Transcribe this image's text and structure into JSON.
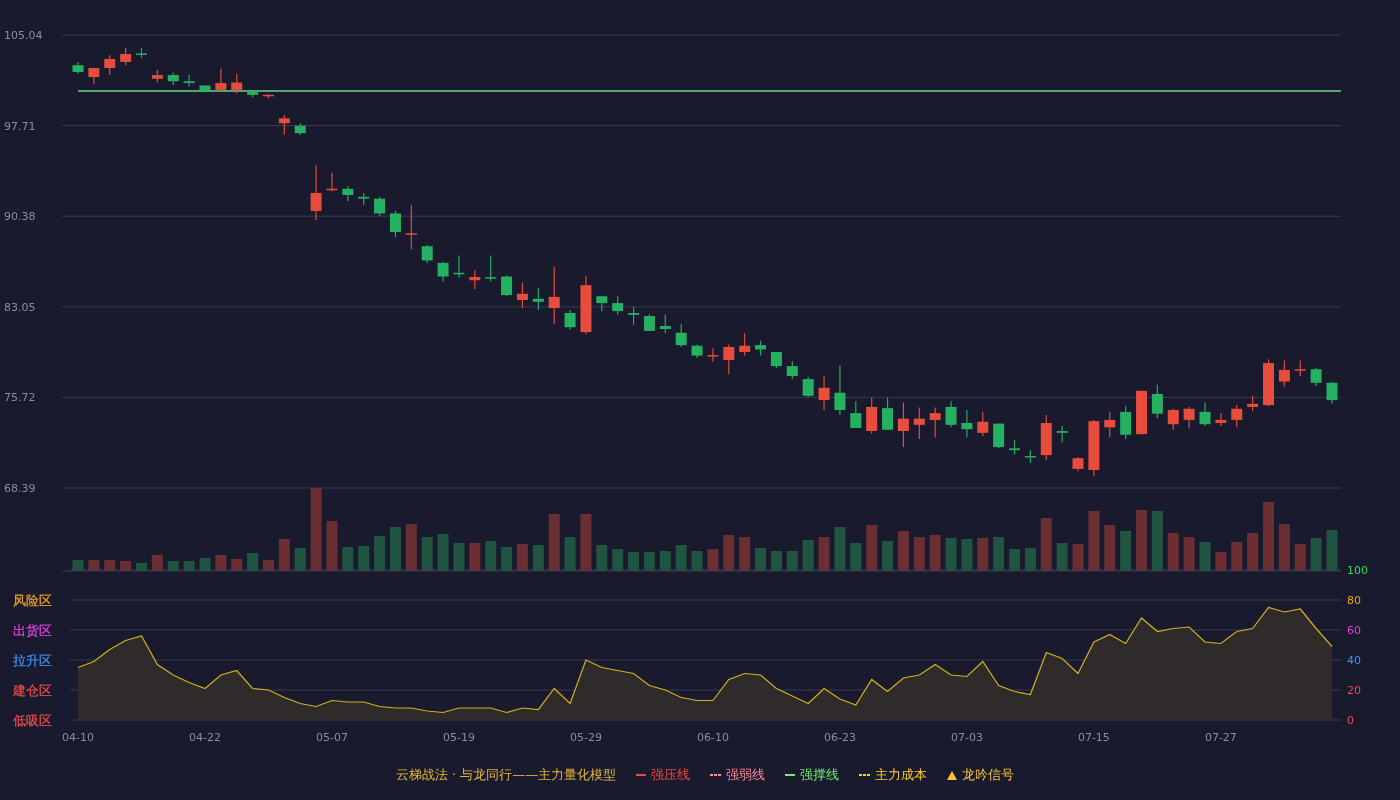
{
  "price_chart": {
    "chart_data": {
      "type": "candlestick",
      "ylim": [
        68.39,
        105.04
      ],
      "grid": true,
      "categories": [
        null,
        null,
        null,
        null,
        null,
        null,
        null,
        null,
        null,
        null,
        null,
        null,
        null,
        null,
        null,
        null,
        null,
        null,
        null,
        null,
        null,
        null,
        null,
        null,
        null,
        null,
        null,
        null,
        null,
        null,
        null,
        null,
        null,
        null,
        null,
        null,
        null,
        null,
        null,
        null,
        null,
        null,
        null,
        null,
        null,
        null,
        null,
        null,
        null,
        null,
        null,
        null,
        null,
        null,
        null,
        null,
        null,
        null,
        null,
        null,
        null,
        null,
        null,
        null,
        null,
        null,
        null,
        null,
        null,
        null,
        null,
        null,
        null,
        null,
        null,
        null,
        null,
        null,
        null,
        null
      ],
      "yticks": [
        {
          "value": 105.04,
          "label": "105.04"
        },
        {
          "value": 97.71,
          "label": "97.71"
        },
        {
          "value": 90.38,
          "label": "90.38"
        },
        {
          "value": 83.05,
          "label": "83.05"
        },
        {
          "value": 75.72,
          "label": "75.72"
        },
        {
          "value": 68.39,
          "label": "68.39"
        }
      ],
      "ohlc": [
        [
          102.6,
          102.85,
          101.9,
          102.05
        ],
        [
          101.64,
          102.4,
          101.07,
          102.37
        ],
        [
          102.37,
          103.4,
          101.8,
          103.1
        ],
        [
          102.86,
          104.0,
          102.6,
          103.5
        ],
        [
          103.55,
          104.0,
          103.2,
          103.45
        ],
        [
          101.5,
          102.2,
          101.2,
          101.8
        ],
        [
          101.8,
          102.0,
          101.0,
          101.3
        ],
        [
          101.3,
          101.8,
          100.9,
          101.15
        ],
        [
          100.95,
          101.0,
          100.4,
          100.55
        ],
        [
          100.6,
          102.3,
          100.5,
          101.15
        ],
        [
          100.6,
          101.9,
          100.3,
          101.2
        ],
        [
          100.5,
          100.5,
          100.0,
          100.2
        ],
        [
          100.1,
          100.25,
          99.9,
          100.2
        ],
        [
          97.9,
          98.55,
          97.0,
          98.3
        ],
        [
          97.7,
          97.9,
          96.95,
          97.1
        ],
        [
          90.8,
          94.5,
          90.05,
          92.26
        ],
        [
          92.5,
          93.9,
          92.4,
          92.6
        ],
        [
          92.6,
          92.8,
          91.6,
          92.1
        ],
        [
          91.95,
          92.25,
          91.3,
          91.8
        ],
        [
          91.8,
          91.95,
          90.4,
          90.6
        ],
        [
          90.6,
          90.8,
          88.7,
          89.1
        ],
        [
          88.9,
          91.3,
          87.7,
          89.0
        ],
        [
          87.95,
          88.05,
          86.6,
          86.8
        ],
        [
          86.6,
          86.7,
          85.1,
          85.5
        ],
        [
          85.8,
          87.2,
          85.4,
          85.7
        ],
        [
          85.2,
          86.0,
          84.5,
          85.46
        ],
        [
          85.45,
          87.2,
          85.1,
          85.35
        ],
        [
          85.5,
          85.6,
          83.9,
          84.0
        ],
        [
          83.6,
          85.0,
          82.95,
          84.1
        ],
        [
          83.7,
          84.6,
          82.8,
          83.45
        ],
        [
          82.95,
          86.3,
          81.65,
          83.85
        ],
        [
          82.55,
          82.8,
          81.2,
          81.4
        ],
        [
          81.0,
          85.55,
          80.85,
          84.8
        ],
        [
          83.9,
          83.9,
          82.7,
          83.35
        ],
        [
          83.35,
          83.9,
          82.4,
          82.7
        ],
        [
          82.55,
          83.05,
          81.6,
          82.4
        ],
        [
          82.3,
          82.45,
          81.1,
          81.1
        ],
        [
          81.5,
          82.4,
          80.9,
          81.25
        ],
        [
          80.95,
          81.65,
          79.8,
          79.95
        ],
        [
          79.9,
          80.0,
          78.9,
          79.1
        ],
        [
          79.05,
          79.7,
          78.6,
          79.15
        ],
        [
          78.75,
          80.0,
          77.6,
          79.8
        ],
        [
          79.4,
          80.9,
          79.1,
          79.9
        ],
        [
          79.95,
          80.3,
          79.1,
          79.6
        ],
        [
          79.4,
          79.4,
          78.1,
          78.25
        ],
        [
          78.25,
          78.65,
          77.2,
          77.45
        ],
        [
          77.2,
          77.4,
          75.75,
          75.85
        ],
        [
          75.5,
          77.45,
          74.7,
          76.5
        ],
        [
          76.1,
          78.3,
          74.3,
          74.7
        ],
        [
          74.45,
          75.4,
          73.25,
          73.25
        ],
        [
          73.0,
          75.7,
          72.8,
          74.95
        ],
        [
          74.85,
          75.7,
          73.1,
          73.1
        ],
        [
          73.0,
          75.3,
          71.7,
          74.0
        ],
        [
          73.5,
          74.9,
          72.35,
          74.0
        ],
        [
          73.9,
          74.9,
          72.5,
          74.45
        ],
        [
          74.95,
          75.4,
          73.3,
          73.5
        ],
        [
          73.65,
          74.7,
          72.5,
          73.15
        ],
        [
          72.85,
          74.55,
          72.6,
          73.75
        ],
        [
          73.6,
          73.6,
          71.6,
          71.7
        ],
        [
          71.6,
          72.25,
          71.1,
          71.45
        ],
        [
          70.98,
          71.45,
          70.4,
          70.9
        ],
        [
          71.05,
          74.3,
          70.65,
          73.65
        ],
        [
          73.0,
          73.4,
          72.1,
          72.85
        ],
        [
          69.93,
          70.9,
          69.75,
          70.8
        ],
        [
          69.85,
          73.9,
          69.36,
          73.8
        ],
        [
          73.3,
          74.55,
          72.5,
          73.9
        ],
        [
          74.55,
          75.0,
          72.35,
          72.7
        ],
        [
          72.75,
          76.3,
          72.7,
          76.25
        ],
        [
          76.0,
          76.75,
          74.05,
          74.4
        ],
        [
          73.55,
          74.8,
          73.1,
          74.7
        ],
        [
          73.9,
          74.95,
          73.2,
          74.8
        ],
        [
          74.55,
          75.3,
          73.4,
          73.55
        ],
        [
          73.65,
          74.45,
          73.4,
          73.9
        ],
        [
          73.9,
          75.1,
          73.3,
          74.8
        ],
        [
          74.95,
          75.85,
          74.6,
          75.2
        ],
        [
          75.1,
          78.8,
          75.0,
          78.5
        ],
        [
          77.0,
          78.7,
          76.6,
          77.95
        ],
        [
          77.95,
          78.7,
          77.45,
          78.0
        ],
        [
          78.0,
          78.1,
          76.65,
          76.9
        ],
        [
          76.9,
          76.95,
          75.2,
          75.5
        ]
      ],
      "ref_lines": [
        {
          "axis": "y",
          "value": 100.51,
          "color": "#6fcf86"
        }
      ]
    }
  },
  "indicator_chart": {
    "zones": [
      {
        "label": "风险区",
        "color": "#f0a020"
      },
      {
        "label": "出货区",
        "color": "#e040e0"
      },
      {
        "label": "拉升区",
        "color": "#3d8fef"
      },
      {
        "label": "建仓区",
        "color": "#e84c4c"
      },
      {
        "label": "低吸区",
        "color": "#e84c4c"
      }
    ],
    "tick_styles": [
      {
        "color": "#33dd55"
      },
      {
        "color": "#f0a020"
      },
      {
        "color": "#e040e0"
      },
      {
        "color": "#3d8fef"
      },
      {
        "color": "#e84c4c"
      },
      {
        "color": "#e84c4c"
      }
    ],
    "chart_data": {
      "type": "area",
      "ylim": [
        0,
        100
      ],
      "grid": true,
      "categories": [
        "04-10",
        null,
        null,
        null,
        null,
        null,
        null,
        null,
        "04-22",
        null,
        null,
        null,
        null,
        null,
        null,
        null,
        "05-07",
        null,
        null,
        null,
        null,
        null,
        null,
        null,
        "05-19",
        null,
        null,
        null,
        null,
        null,
        null,
        null,
        "05-29",
        null,
        null,
        null,
        null,
        null,
        null,
        null,
        "06-10",
        null,
        null,
        null,
        null,
        null,
        null,
        null,
        "06-23",
        null,
        null,
        null,
        null,
        null,
        null,
        null,
        "07-03",
        null,
        null,
        null,
        null,
        null,
        null,
        null,
        "07-15",
        null,
        null,
        null,
        null,
        null,
        null,
        null,
        "07-27",
        null,
        null,
        null,
        null,
        null,
        null,
        null
      ],
      "yticks": [
        {
          "value": 100,
          "label": "100"
        },
        {
          "value": 80,
          "label": "80"
        },
        {
          "value": 60,
          "label": "60"
        },
        {
          "value": 40,
          "label": "40"
        },
        {
          "value": 20,
          "label": "20"
        },
        {
          "value": 0,
          "label": "0"
        }
      ],
      "series": [
        {
          "color": "#d4b01c",
          "values": [
            35,
            39,
            47,
            53,
            56,
            37,
            30,
            25,
            21,
            30,
            33,
            21,
            20,
            15,
            11,
            9,
            13,
            12,
            12,
            9,
            8,
            8,
            6,
            5,
            8,
            8,
            8,
            5,
            8,
            7,
            21,
            11,
            40,
            35,
            33,
            31,
            23,
            20,
            15,
            13,
            13,
            27,
            31,
            30,
            21,
            16,
            11,
            21,
            14,
            10,
            27,
            19,
            28,
            30,
            37,
            30,
            29,
            39,
            23,
            19,
            17,
            45,
            41,
            31,
            52,
            57,
            51,
            68,
            59,
            61,
            62,
            52,
            51,
            59,
            61,
            75,
            72,
            74,
            61,
            49
          ]
        }
      ]
    }
  },
  "legend": {
    "title": "云梯战法 · 与龙同行——主力量化模型",
    "items": [
      {
        "label": "强压线",
        "kind": "line",
        "color": "#f0483e"
      },
      {
        "label": "强弱线",
        "kind": "dashed",
        "color": "#ff8a9a"
      },
      {
        "label": "强撑线",
        "kind": "line",
        "color": "#6ef06e"
      },
      {
        "label": "主力成本",
        "kind": "dashed",
        "color": "#ffd21a"
      },
      {
        "label": "龙吟信号",
        "kind": "triangle",
        "color": "#f5c542"
      }
    ]
  }
}
